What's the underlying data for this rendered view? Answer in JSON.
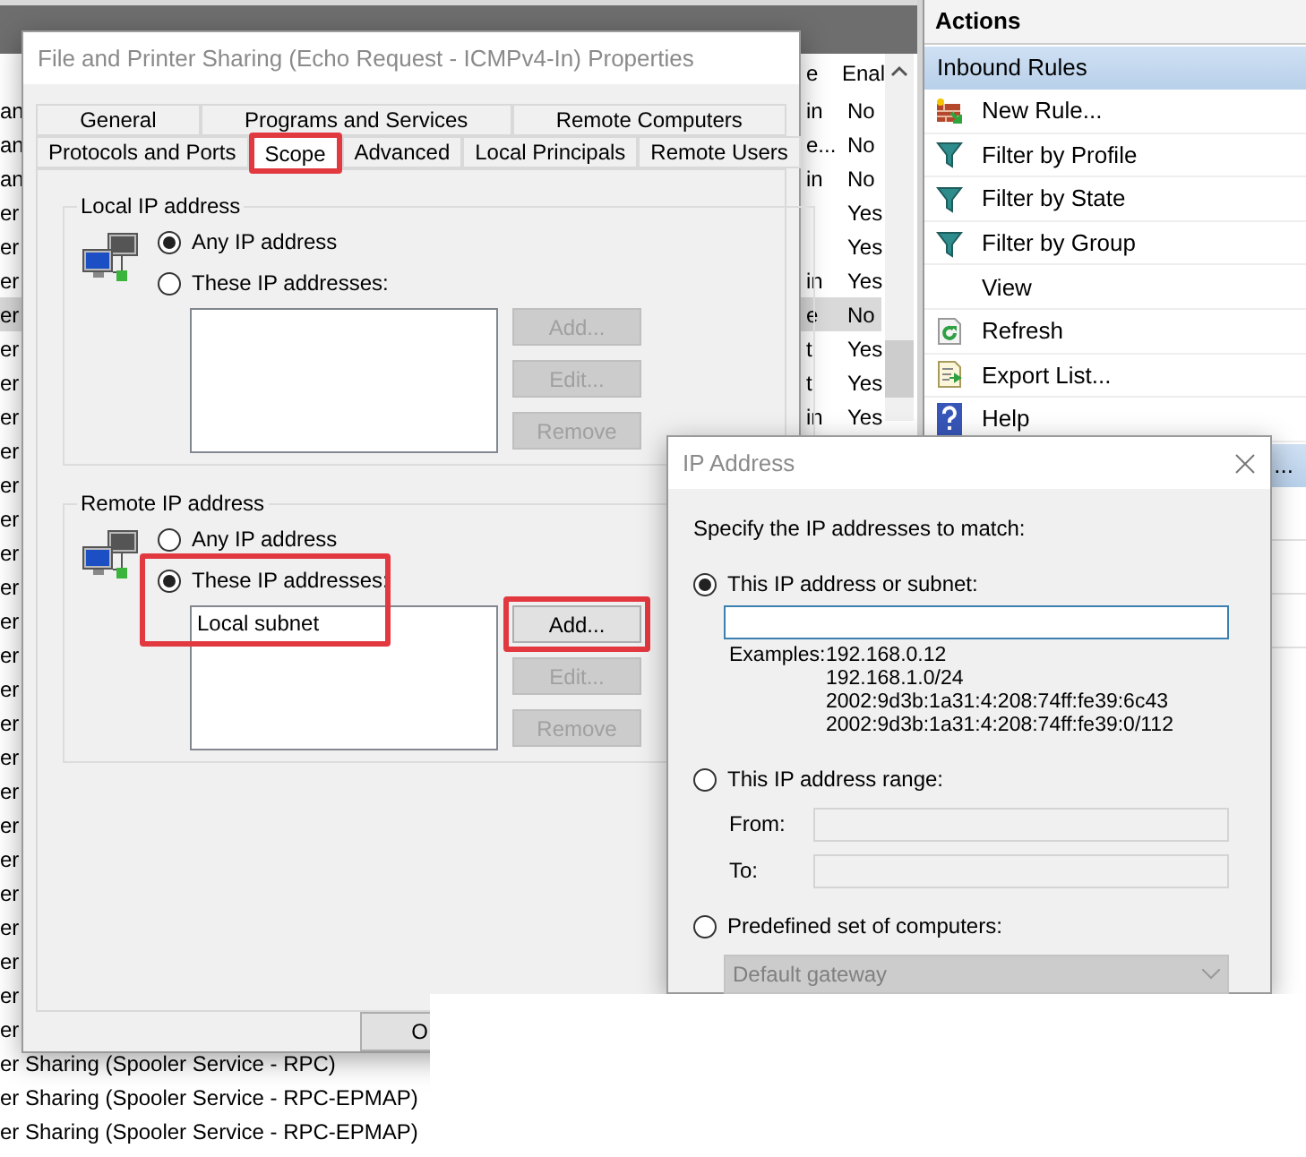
{
  "rule_list": {
    "columns": [
      "e",
      "Enal"
    ],
    "rows": [
      {
        "name": "an",
        "group": "in",
        "enabled": "No",
        "selected": false
      },
      {
        "name": "an",
        "group": "e...",
        "enabled": "No",
        "selected": false
      },
      {
        "name": "an",
        "group": "in",
        "enabled": "No",
        "selected": false
      },
      {
        "name": "er",
        "enabled": "Yes",
        "selected": false
      },
      {
        "name": "er",
        "enabled": "Yes",
        "selected": false
      },
      {
        "name": "er",
        "group": "in",
        "enabled": "Yes",
        "selected": false
      },
      {
        "name": "er",
        "group": "e",
        "enabled": "No",
        "selected": true
      },
      {
        "name": "er",
        "group": "t",
        "enabled": "Yes",
        "selected": false
      },
      {
        "name": "er",
        "group": "t",
        "enabled": "Yes",
        "selected": false
      },
      {
        "name": "er",
        "group": "in",
        "enabled": "Yes",
        "selected": false
      },
      {
        "name": "er",
        "selected": false
      },
      {
        "name": "er",
        "selected": false
      },
      {
        "name": "er",
        "selected": false
      },
      {
        "name": "er",
        "selected": false
      },
      {
        "name": "er",
        "selected": false
      },
      {
        "name": "er",
        "selected": false
      },
      {
        "name": "er",
        "selected": false
      },
      {
        "name": "er",
        "selected": false
      },
      {
        "name": "er",
        "selected": false
      },
      {
        "name": "er",
        "selected": false
      },
      {
        "name": "er",
        "selected": false
      },
      {
        "name": "er",
        "selected": false
      },
      {
        "name": "er",
        "selected": false
      },
      {
        "name": "er",
        "selected": false
      },
      {
        "name": "er",
        "selected": false
      },
      {
        "name": "er",
        "selected": false
      },
      {
        "name": "er",
        "selected": false
      },
      {
        "name": "er",
        "selected": false
      },
      {
        "name": "er Sharing (Spooler Service - RPC)",
        "selected": false
      },
      {
        "name": "er Sharing (Spooler Service - RPC-EPMAP)",
        "selected": false
      },
      {
        "name": "er Sharing (Spooler Service - RPC-EPMAP)",
        "selected": false
      }
    ]
  },
  "actions": {
    "title": "Actions",
    "section": "Inbound Rules",
    "items": [
      {
        "label": "New Rule...",
        "kind": "new-rule"
      },
      {
        "label": "Filter by Profile",
        "kind": "filter"
      },
      {
        "label": "Filter by State",
        "kind": "filter"
      },
      {
        "label": "Filter by Group",
        "kind": "filter"
      },
      {
        "label": "View",
        "kind": "none"
      },
      {
        "label": "Refresh",
        "kind": "refresh"
      },
      {
        "label": "Export List...",
        "kind": "export"
      },
      {
        "label": "Help",
        "kind": "help"
      }
    ],
    "section_2": "..."
  },
  "properties_dialog": {
    "title": "File and Printer Sharing (Echo Request - ICMPv4-In) Properties",
    "tabs_row_1": [
      {
        "label": "General",
        "selected": false,
        "highlighted": false
      },
      {
        "label": "Programs and Services",
        "selected": false,
        "highlighted": false
      },
      {
        "label": "Remote Computers",
        "selected": false,
        "highlighted": false
      }
    ],
    "tabs_row_2": [
      {
        "label": "Protocols and Ports",
        "selected": false,
        "highlighted": false
      },
      {
        "label": "Scope",
        "selected": true,
        "highlighted": true
      },
      {
        "label": "Advanced",
        "selected": false,
        "highlighted": false
      },
      {
        "label": "Local Principals",
        "selected": false,
        "highlighted": false
      },
      {
        "label": "Remote Users",
        "selected": false,
        "highlighted": false
      }
    ],
    "groups": [
      {
        "title": "Local IP address",
        "options": [
          {
            "label": "Any IP address",
            "selected": true,
            "highlighted": false
          },
          {
            "label": "These IP addresses:",
            "selected": false,
            "highlighted": false
          }
        ],
        "buttons": [
          {
            "label": "Add...",
            "disabled": true,
            "highlighted": false
          },
          {
            "label": "Edit...",
            "disabled": true,
            "highlighted": false
          },
          {
            "label": "Remove",
            "disabled": true,
            "highlighted": false
          }
        ]
      },
      {
        "title": "Remote IP address",
        "options": [
          {
            "label": "Any IP address",
            "selected": false,
            "highlighted": false
          },
          {
            "label": "These IP addresses:",
            "selected": true,
            "highlighted": true
          }
        ],
        "addresses": [
          "Local subnet"
        ],
        "buttons": [
          {
            "label": "Add...",
            "disabled": false,
            "highlighted": true
          },
          {
            "label": "Edit...",
            "disabled": true,
            "highlighted": false
          },
          {
            "label": "Remove",
            "disabled": true,
            "highlighted": false
          }
        ]
      }
    ],
    "footer_button": "O"
  },
  "ip_dialog": {
    "title": "IP Address",
    "prompt": "Specify the IP addresses to match:",
    "options": [
      {
        "label": "This IP address or subnet:",
        "selected": true
      },
      {
        "label": "This IP address range:",
        "selected": false
      },
      {
        "label": "Predefined set of computers:",
        "selected": false
      }
    ],
    "examples_label": "Examples:",
    "examples": [
      "192.168.0.12",
      "192.168.1.0/24",
      "2002:9d3b:1a31:4:208:74ff:fe39:6c43",
      "2002:9d3b:1a31:4:208:74ff:fe39:0/112"
    ],
    "range_fields": [
      {
        "label": "From:",
        "disabled": true
      },
      {
        "label": "To:",
        "disabled": true
      }
    ],
    "predefined": {
      "value": "Default gateway",
      "disabled": true
    }
  }
}
